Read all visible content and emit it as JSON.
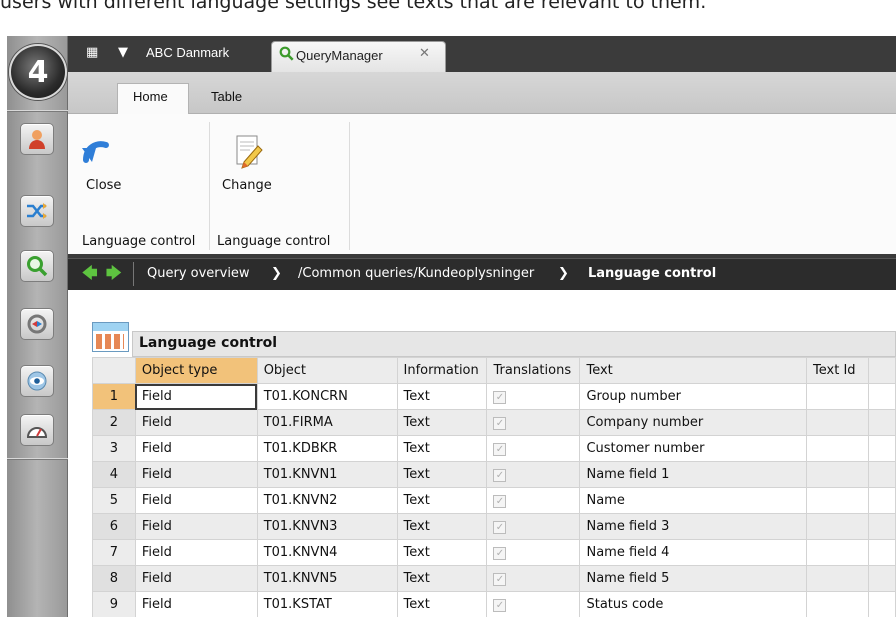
{
  "caption": "users with different language settings see texts that are relevant to them.",
  "tabs": {
    "company": "ABC Danmark",
    "active": "QueryManager"
  },
  "ribbon": {
    "tabs": [
      "Home",
      "Table"
    ],
    "close_label": "Close",
    "change_label": "Change",
    "group1": "Language control",
    "group2": "Language control"
  },
  "breadcrumb": {
    "items": [
      "Query overview",
      "/Common queries/Kundeoplysninger",
      "Language control"
    ]
  },
  "grid": {
    "title": "Language control",
    "columns": [
      "Object type",
      "Object",
      "Information",
      "Translations",
      "Text",
      "Text Id"
    ],
    "rows": [
      {
        "n": "1",
        "type": "Field",
        "object": "T01.KONCRN",
        "info": "Text",
        "translated": true,
        "text": "Group number",
        "textid": ""
      },
      {
        "n": "2",
        "type": "Field",
        "object": "T01.FIRMA",
        "info": "Text",
        "translated": true,
        "text": "Company number",
        "textid": ""
      },
      {
        "n": "3",
        "type": "Field",
        "object": "T01.KDBKR",
        "info": "Text",
        "translated": true,
        "text": "Customer number",
        "textid": ""
      },
      {
        "n": "4",
        "type": "Field",
        "object": "T01.KNVN1",
        "info": "Text",
        "translated": true,
        "text": "Name field 1",
        "textid": ""
      },
      {
        "n": "5",
        "type": "Field",
        "object": "T01.KNVN2",
        "info": "Text",
        "translated": true,
        "text": "Name",
        "textid": ""
      },
      {
        "n": "6",
        "type": "Field",
        "object": "T01.KNVN3",
        "info": "Text",
        "translated": true,
        "text": "Name field 3",
        "textid": ""
      },
      {
        "n": "7",
        "type": "Field",
        "object": "T01.KNVN4",
        "info": "Text",
        "translated": true,
        "text": "Name field 4",
        "textid": ""
      },
      {
        "n": "8",
        "type": "Field",
        "object": "T01.KNVN5",
        "info": "Text",
        "translated": true,
        "text": "Name field 5",
        "textid": ""
      },
      {
        "n": "9",
        "type": "Field",
        "object": "T01.KSTAT",
        "info": "Text",
        "translated": true,
        "text": "Status code",
        "textid": ""
      }
    ]
  },
  "icons": {
    "logo": "app-logo-icon",
    "side": [
      "user-icon",
      "shuffle-icon",
      "search-icon",
      "sync-icon",
      "eye-gear-icon",
      "gauge-icon"
    ],
    "close": "undo-arrow-icon",
    "change": "edit-document-icon"
  },
  "colors": {
    "accent": "#f2c27a",
    "tab_green": "#3b9a2b",
    "dark_bar": "#2c2c2c"
  }
}
